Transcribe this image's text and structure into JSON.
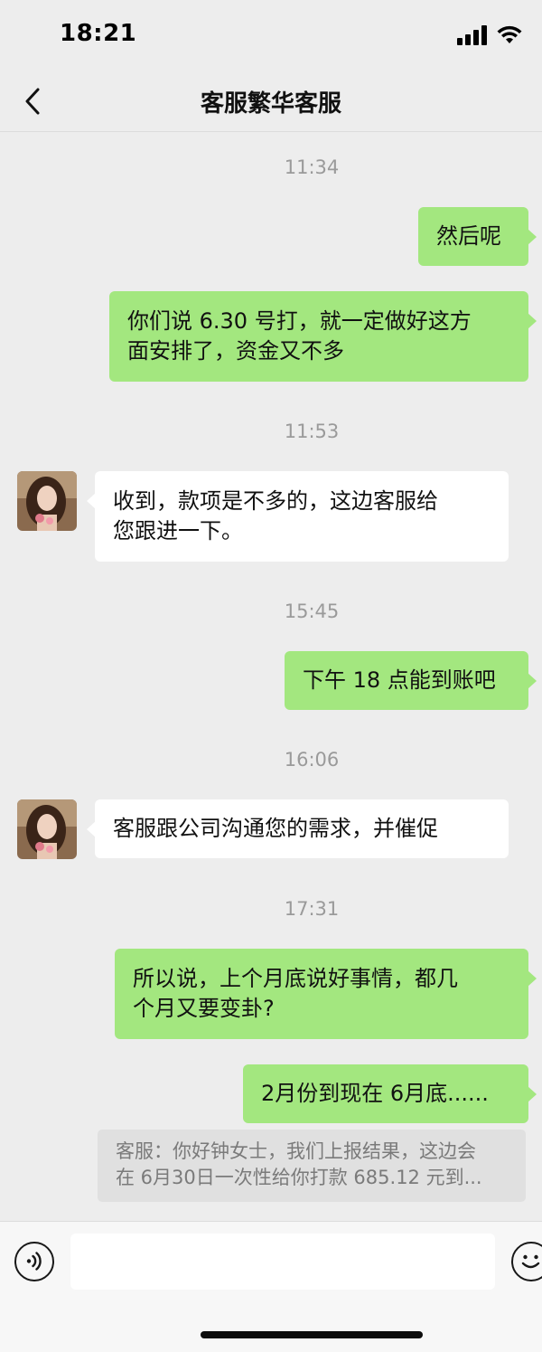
{
  "status": {
    "time": "18:21"
  },
  "nav": {
    "title": "客服繁华客服"
  },
  "messages": {
    "ts1": "11:34",
    "m1": "然后呢",
    "m2_l1": "你们说 6.30 号打，就一定做好这方",
    "m2_l2": "面安排了，资金又不多",
    "ts2": "11:53",
    "m3_l1": "收到，款项是不多的，这边客服给",
    "m3_l2": "您跟进一下。",
    "ts3": "15:45",
    "m4": "下午 18 点能到账吧",
    "ts4": "16:06",
    "m5": "客服跟公司沟通您的需求，并催促",
    "ts5": "17:31",
    "m6_l1": "所以说，上个月底说好事情，都几",
    "m6_l2": "个月又要变卦?",
    "m7": "2月份到现在 6月底......"
  },
  "quote": {
    "l1": "客服：你好钟女士，我们上报结果，这边会",
    "l2": "在 6月30日一次性给你打款 685.12 元到..."
  },
  "icons": {
    "back": "chevron-left-icon",
    "signal": "signal-icon",
    "wifi": "wifi-icon",
    "voice": "voice-icon",
    "emoji": "emoji-icon"
  },
  "colors": {
    "outgoing": "#a3e77f",
    "incoming": "#ffffff",
    "background": "#ededed"
  }
}
